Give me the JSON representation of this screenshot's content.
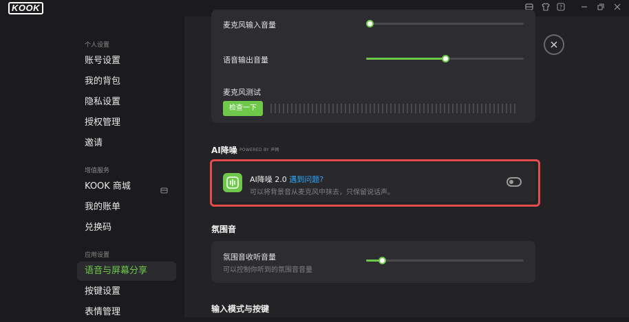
{
  "app": {
    "logo": "KOOK"
  },
  "titlebar": {
    "icons": [
      "inbox-icon",
      "shirt-icon",
      "help-icon",
      "minimize-icon",
      "restore-icon",
      "close-icon"
    ]
  },
  "sidebar": {
    "sections": [
      {
        "title": "个人设置",
        "items": [
          "账号设置",
          "我的背包",
          "隐私设置",
          "授权管理",
          "邀请"
        ]
      },
      {
        "title": "增值服务",
        "items": [
          "KOOK 商城",
          "我的账单",
          "兑换码"
        ]
      },
      {
        "title": "应用设置",
        "items": [
          "语音与屏幕分享",
          "按键设置",
          "表情管理"
        ]
      }
    ],
    "active_item": "语音与屏幕分享"
  },
  "main": {
    "mic_input_label": "麦克风输入音量",
    "mic_input_value": 0,
    "voice_output_label": "语音输出音量",
    "voice_output_value": 0.5,
    "mic_test_label": "麦克风测试",
    "mic_test_button": "检查一下",
    "ai_section_title": "AI降噪",
    "ai_powered_by": "POWERED BY 声网",
    "ai_card": {
      "title": "AI降噪 2.0",
      "link": "遇到问题?",
      "desc": "可以将背景音从麦克风中抹去，只保留说话声。",
      "enabled": false
    },
    "ambient_section_title": "氛围音",
    "ambient_label": "氛围音收听音量",
    "ambient_desc": "可以控制你听到的氛围音音量",
    "ambient_value": 0.1,
    "input_mode_title": "输入模式与按键"
  },
  "colors": {
    "accent": "#6ec84a",
    "link": "#2fa8ff",
    "highlight": "#e74c4c"
  }
}
